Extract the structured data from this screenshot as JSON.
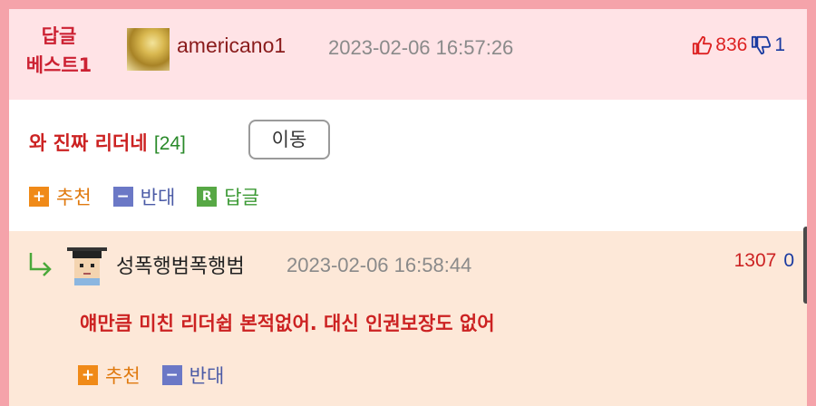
{
  "best": {
    "badge_line1": "답글",
    "badge_line2": "베스트1",
    "username": "americano1",
    "datetime": "2023-02-06 16:57:26",
    "up_votes": "836",
    "down_votes": "1"
  },
  "comment": {
    "text": "와 진짜 리더네",
    "reply_count": "[24]",
    "move_label": "이동",
    "actions": {
      "recommend": "추천",
      "oppose": "반대",
      "reply": "답글"
    }
  },
  "sub_reply": {
    "username": "성폭행범폭행범",
    "datetime": "2023-02-06 16:58:44",
    "up_votes": "1307",
    "down_votes": "0",
    "text": "얘만큼 미친 리더쉽 본적없어. 대신 인권보장도 없어",
    "actions": {
      "recommend": "추천",
      "oppose": "반대"
    }
  },
  "icons": {
    "plus": "+",
    "minus": "−",
    "reply": "R"
  },
  "colors": {
    "frame": "#f5a3aa",
    "best_bg": "#ffe3e6",
    "sub_reply_bg": "#fde8d8",
    "accent_red": "#cc2222",
    "accent_blue": "#1a3aa0"
  }
}
